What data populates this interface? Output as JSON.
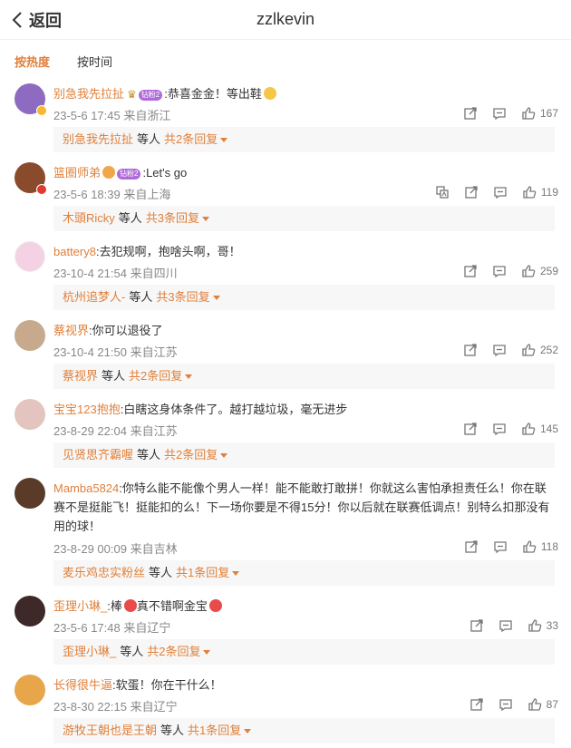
{
  "header": {
    "back_label": "返回",
    "title": "zzlkevin"
  },
  "sort": {
    "hot": "按热度",
    "time": "按时间"
  },
  "common": {
    "reply_prefix_sep": "等人"
  },
  "comments": [
    {
      "name": "别急我先拉扯",
      "badge": "钻粉2",
      "crown": true,
      "text": ":恭喜金金！等出鞋",
      "emoji": "face",
      "meta": "23-5-6 17:45 来自浙江",
      "likes": "167",
      "reply_name": "别急我先拉扯",
      "reply_more": "共2条回复",
      "avatar_color": "#8d6bc0",
      "vbadge_color": "#f5b82e"
    },
    {
      "name": "篮圈师弟",
      "badge": "钻粉2",
      "crown": false,
      "text": ":Let's go",
      "emoji": "",
      "meta": "23-5-6 18:39 来自上海",
      "likes": "119",
      "reply_name": "木頭Ricky",
      "reply_more": "共3条回复",
      "avatar_color": "#8a4a2c",
      "vbadge_color": "#e03a2e"
    },
    {
      "name": "battery8",
      "badge": "",
      "crown": false,
      "text": ":去犯规啊，抱啥头啊，哥！",
      "emoji": "",
      "meta": "23-10-4 21:54 来自四川",
      "likes": "259",
      "reply_name": "杭州追梦人-",
      "reply_more": "共3条回复",
      "avatar_color": "#f4d2e4",
      "vbadge_color": ""
    },
    {
      "name": "蔡视界",
      "badge": "",
      "crown": false,
      "text": ":你可以退役了",
      "emoji": "",
      "meta": "23-10-4 21:50 来自江苏",
      "likes": "252",
      "reply_name": "蔡视界",
      "reply_more": "共2条回复",
      "avatar_color": "#c7a98e",
      "vbadge_color": ""
    },
    {
      "name": "宝宝123抱抱",
      "badge": "",
      "crown": false,
      "text": ":白瞎这身体条件了。越打越垃圾，毫无进步",
      "emoji": "",
      "meta": "23-8-29 22:04 来自江苏",
      "likes": "145",
      "reply_name": "见贤思齐霸喔",
      "reply_more": "共2条回复",
      "avatar_color": "#e3c4be",
      "vbadge_color": ""
    },
    {
      "name": "Mamba5824",
      "badge": "",
      "crown": false,
      "text": ":你特么能不能像个男人一样！能不能敢打敢拼！你就这么害怕承担责任么！你在联赛不是挺能飞！挺能扣的么！下一场你要是不得15分！你以后就在联赛低调点！别特么扣那没有用的球！",
      "emoji": "",
      "meta": "23-8-29 00:09 来自吉林",
      "likes": "118",
      "reply_name": "麦乐鸡忠实粉丝",
      "reply_more": "共1条回复",
      "avatar_color": "#5a3b2a",
      "vbadge_color": ""
    },
    {
      "name": "歪理小琳_",
      "badge": "",
      "crown": false,
      "text": ":棒",
      "text2": "真不错啊金宝",
      "emoji": "heart",
      "meta": "23-5-6 17:48 来自辽宁",
      "likes": "33",
      "reply_name": "歪理小琳_",
      "reply_more": "共2条回复",
      "avatar_color": "#3d2a28",
      "vbadge_color": ""
    },
    {
      "name": "长得很牛逼",
      "badge": "",
      "crown": false,
      "text": ":软蛋！你在干什么！",
      "emoji": "",
      "meta": "23-8-30 22:15 来自辽宁",
      "likes": "87",
      "reply_name": "游牧王朝也是王朝",
      "reply_more": "共1条回复",
      "avatar_color": "#e7a64a",
      "vbadge_color": ""
    }
  ]
}
